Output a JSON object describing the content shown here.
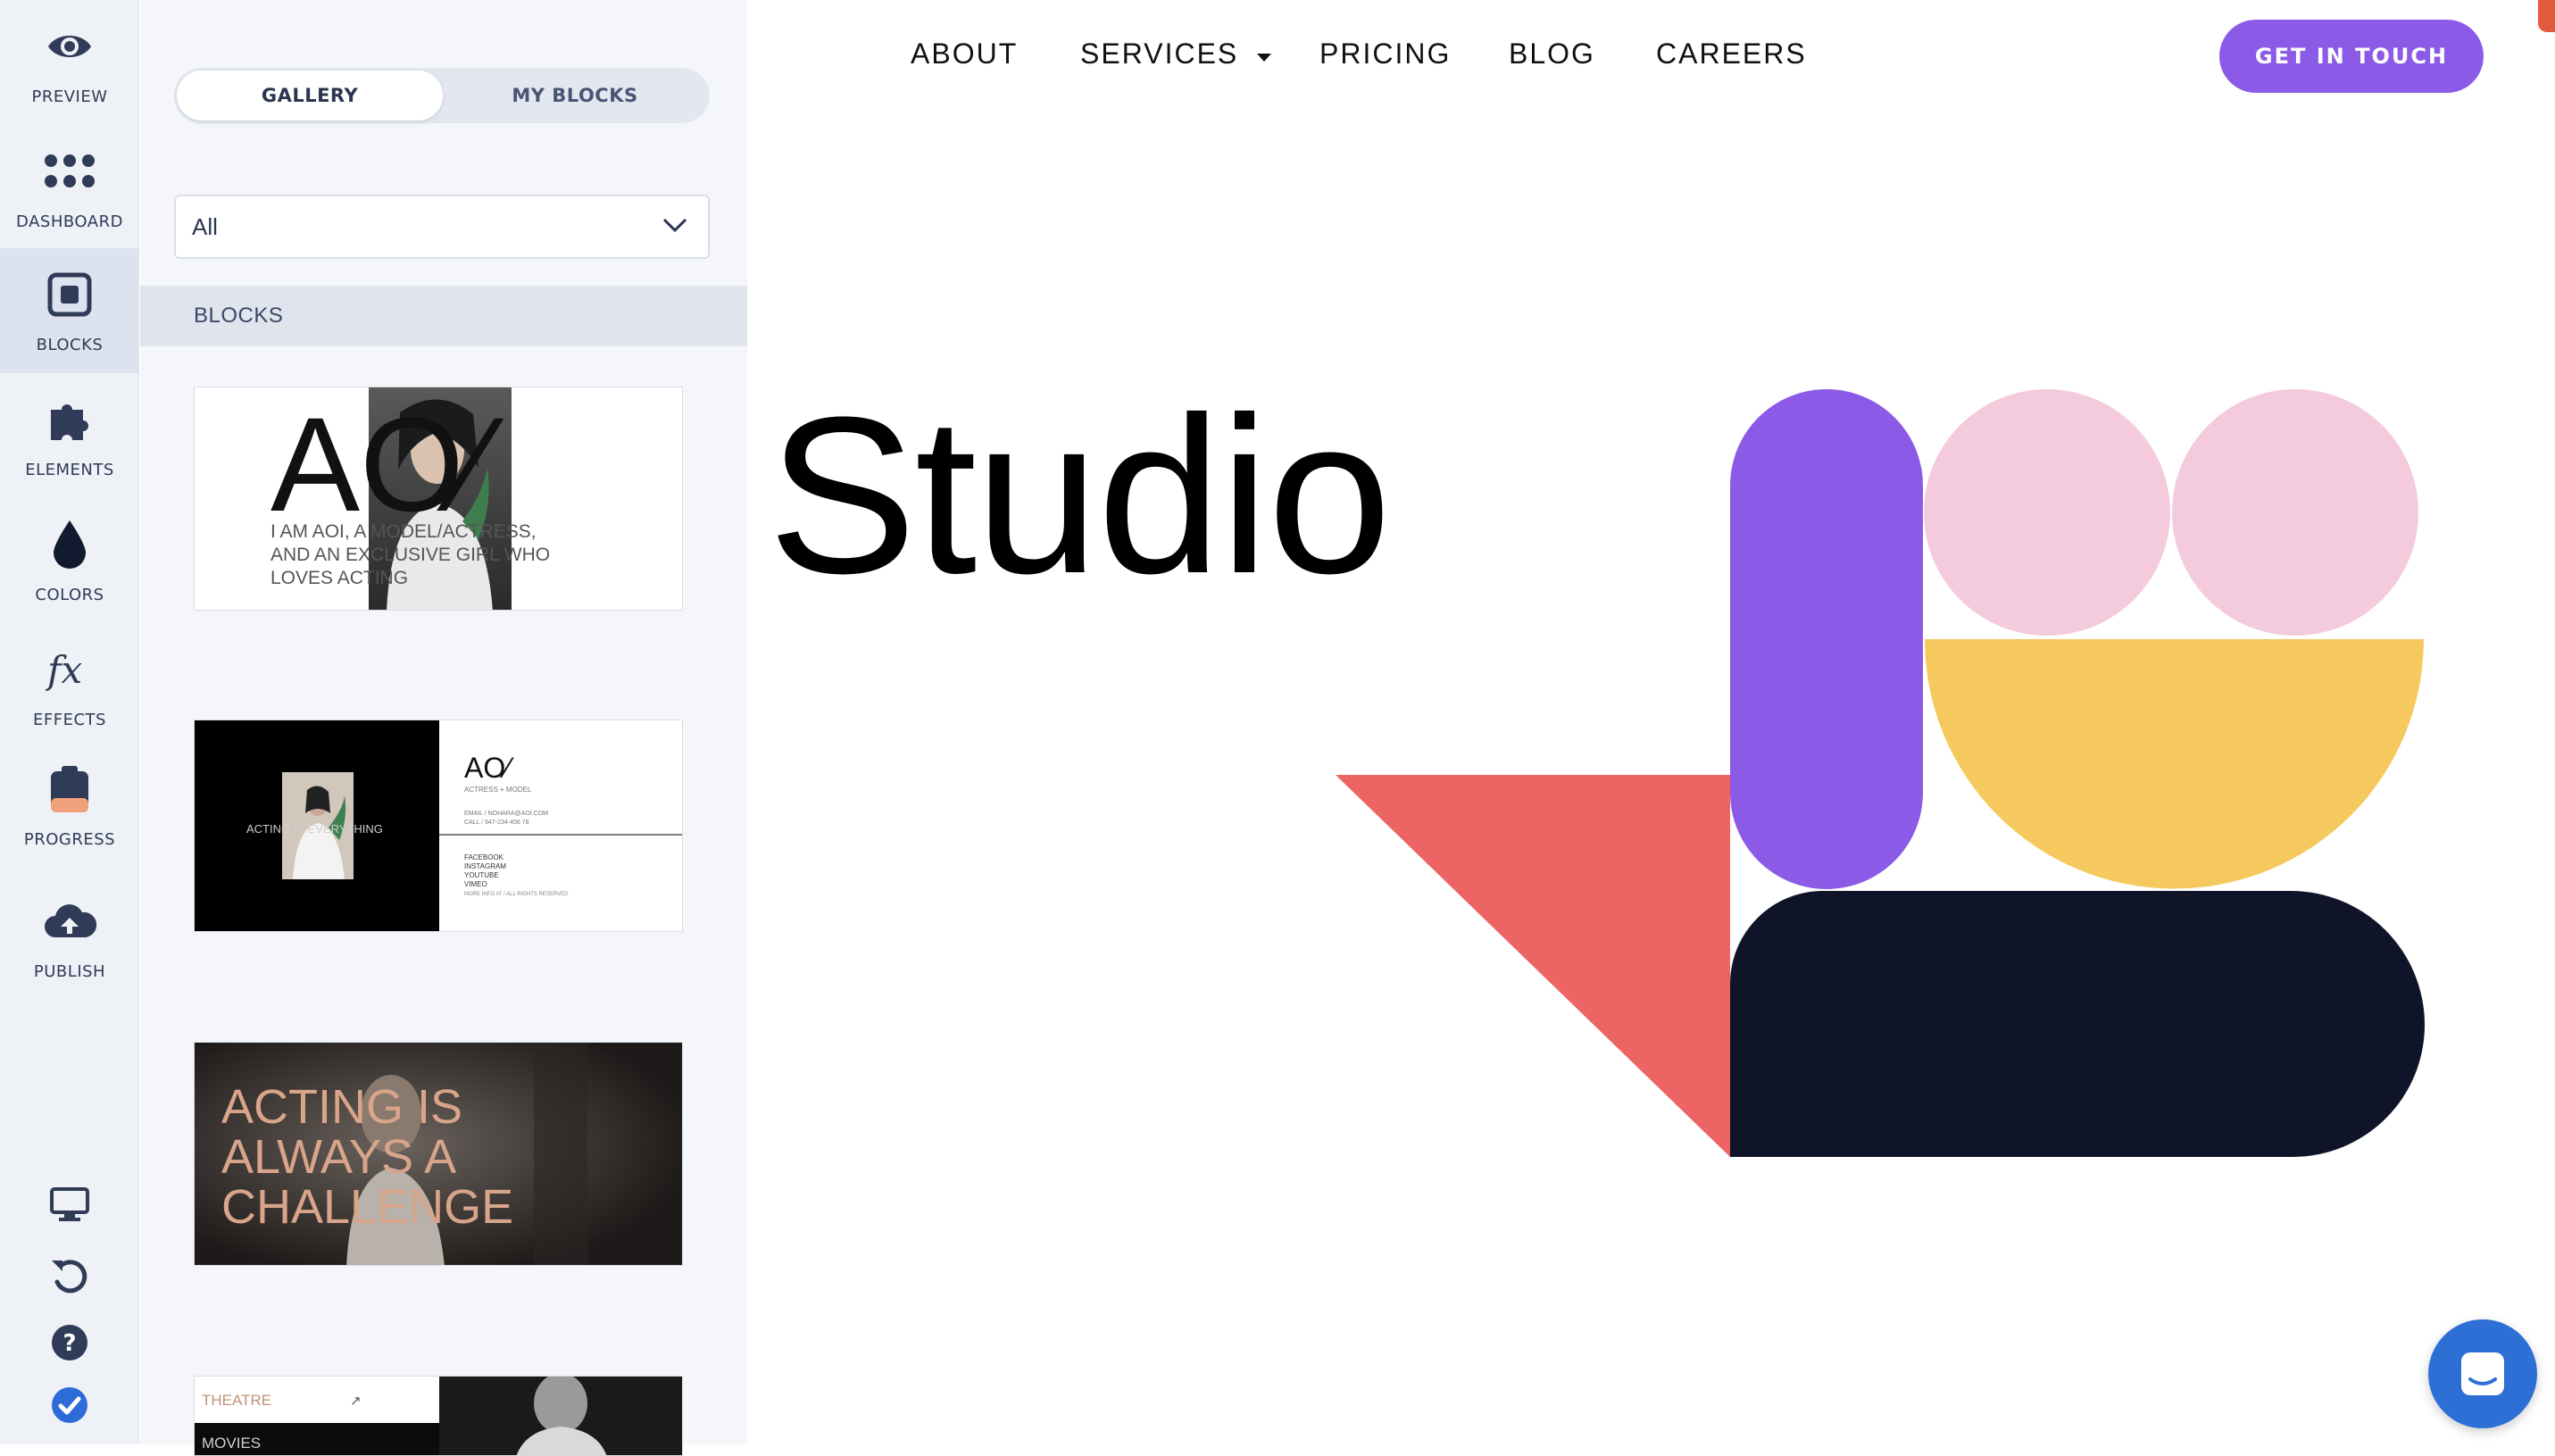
{
  "rail": {
    "items": [
      {
        "label": "PREVIEW",
        "icon": "eye-icon"
      },
      {
        "label": "DASHBOARD",
        "icon": "grid-dots-icon"
      },
      {
        "label": "BLOCKS",
        "icon": "blocks-icon",
        "active": true
      },
      {
        "label": "ELEMENTS",
        "icon": "puzzle-icon"
      },
      {
        "label": "COLORS",
        "icon": "drop-icon"
      },
      {
        "label": "EFFECTS",
        "icon": "fx-icon"
      },
      {
        "label": "PROGRESS",
        "icon": "clipboard-icon"
      },
      {
        "label": "PUBLISH",
        "icon": "cloud-upload-icon"
      }
    ],
    "bottom_icons": [
      "desktop-icon",
      "undo-icon",
      "help-icon",
      "check-circle-icon"
    ]
  },
  "panel": {
    "tabs": {
      "gallery": "GALLERY",
      "my_blocks": "MY BLOCKS"
    },
    "filter": {
      "value": "All"
    },
    "section_title": "BLOCKS",
    "thumbs": {
      "t1": {
        "logo": "AO⁄",
        "text_1": "I AM AOI, A MODEL/ACTRESS,",
        "text_2": "AND AN EXCLUSIVE GIRL WHO",
        "text_3": "LOVES ACTING"
      },
      "t2": {
        "left_text": "ACTING IS EVERYTHING",
        "logo": "AO⁄",
        "subtitle": "ACTRESS + MODEL",
        "contact_1": "EMAIL / NOHARA@AOI.COM",
        "contact_2": "CALL / 647-234-456 78",
        "link_1": "FACEBOOK",
        "link_2": "INSTAGRAM",
        "link_3": "YOUTUBE",
        "link_4": "VIMEO",
        "footer": "MORE INFO AT / ALL RIGHTS RESERVED"
      },
      "t3": {
        "line_1": "ACTING IS",
        "line_2": "ALWAYS A",
        "line_3": "CHALLENGE"
      },
      "t4": {
        "label": "THEATRE",
        "arrow": "↗",
        "label_2": "MOVIES"
      }
    }
  },
  "nav": {
    "about": "ABOUT",
    "services": "SERVICES",
    "pricing": "PRICING",
    "blog": "BLOG",
    "careers": "CAREERS",
    "cta": "GET IN TOUCH"
  },
  "hero": {
    "title": "Studio"
  },
  "colors": {
    "accent_purple": "#8b5be8",
    "pink": "#f4cbdc",
    "yellow": "#f5c95e",
    "coral": "#ec6464",
    "navy": "#0f1429",
    "chat_blue": "#2e6fd6"
  }
}
